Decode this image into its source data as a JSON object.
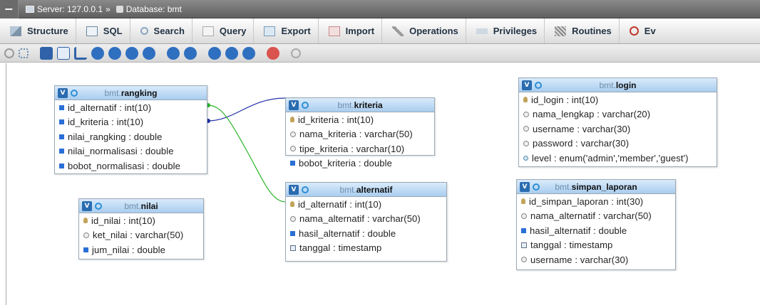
{
  "breadcrumb": {
    "server": "Server: 127.0.0.1",
    "separator": "»",
    "database": "Database: bmt"
  },
  "tabs": [
    {
      "label": "Structure",
      "icon": "structure-icon"
    },
    {
      "label": "SQL",
      "icon": "sql-icon"
    },
    {
      "label": "Search",
      "icon": "search-icon"
    },
    {
      "label": "Query",
      "icon": "query-icon"
    },
    {
      "label": "Export",
      "icon": "export-icon"
    },
    {
      "label": "Import",
      "icon": "import-icon"
    },
    {
      "label": "Operations",
      "icon": "wrench-icon"
    },
    {
      "label": "Privileges",
      "icon": "privileges-icon"
    },
    {
      "label": "Routines",
      "icon": "routines-icon"
    },
    {
      "label": "Ev",
      "icon": "events-icon"
    }
  ],
  "tables": {
    "rangking": {
      "db": "bmt.",
      "name": "rangking",
      "columns": [
        {
          "text": "id_alternatif : int(10)",
          "kind": "num"
        },
        {
          "text": "id_kriteria : int(10)",
          "kind": "num"
        },
        {
          "text": "nilai_rangking : double",
          "kind": "num"
        },
        {
          "text": "nilai_normalisasi : double",
          "kind": "num"
        },
        {
          "text": "bobot_normalisasi : double",
          "kind": "num"
        }
      ]
    },
    "kriteria": {
      "db": "bmt.",
      "name": "kriteria",
      "columns": [
        {
          "text": "id_kriteria : int(10)",
          "kind": "key"
        },
        {
          "text": "nama_kriteria : varchar(50)",
          "kind": "txt"
        },
        {
          "text": "tipe_kriteria : varchar(10)",
          "kind": "txt"
        },
        {
          "text": "bobot_kriteria : double",
          "kind": "num"
        }
      ]
    },
    "login": {
      "db": "bmt.",
      "name": "login",
      "columns": [
        {
          "text": "id_login : int(10)",
          "kind": "key"
        },
        {
          "text": "nama_lengkap : varchar(20)",
          "kind": "txt"
        },
        {
          "text": "username : varchar(30)",
          "kind": "txt"
        },
        {
          "text": "password : varchar(30)",
          "kind": "txt"
        },
        {
          "text": "level : enum('admin','member','guest')",
          "kind": "enm"
        }
      ]
    },
    "nilai": {
      "db": "bmt.",
      "name": "nilai",
      "columns": [
        {
          "text": "id_nilai : int(10)",
          "kind": "key"
        },
        {
          "text": "ket_nilai : varchar(50)",
          "kind": "txt"
        },
        {
          "text": "jum_nilai : double",
          "kind": "num"
        }
      ]
    },
    "alternatif": {
      "db": "bmt.",
      "name": "alternatif",
      "columns": [
        {
          "text": "id_alternatif : int(10)",
          "kind": "key"
        },
        {
          "text": "nama_alternatif : varchar(50)",
          "kind": "txt"
        },
        {
          "text": "hasil_alternatif : double",
          "kind": "num"
        },
        {
          "text": "tanggal : timestamp",
          "kind": "date"
        }
      ]
    },
    "simpan_laporan": {
      "db": "bmt.",
      "name": "simpan_laporan",
      "columns": [
        {
          "text": "id_simpan_laporan : int(30)",
          "kind": "key"
        },
        {
          "text": "nama_alternatif : varchar(50)",
          "kind": "txt"
        },
        {
          "text": "hasil_alternatif : double",
          "kind": "num"
        },
        {
          "text": "tanggal : timestamp",
          "kind": "date"
        },
        {
          "text": "username : varchar(30)",
          "kind": "txt"
        }
      ]
    }
  },
  "relations": [
    {
      "from": "rangking.id_kriteria",
      "to": "kriteria.id_kriteria",
      "color": "#1f2fa8"
    },
    {
      "from": "rangking.id_alternatif",
      "to": "alternatif.id_alternatif",
      "color": "#2bb52b"
    }
  ]
}
